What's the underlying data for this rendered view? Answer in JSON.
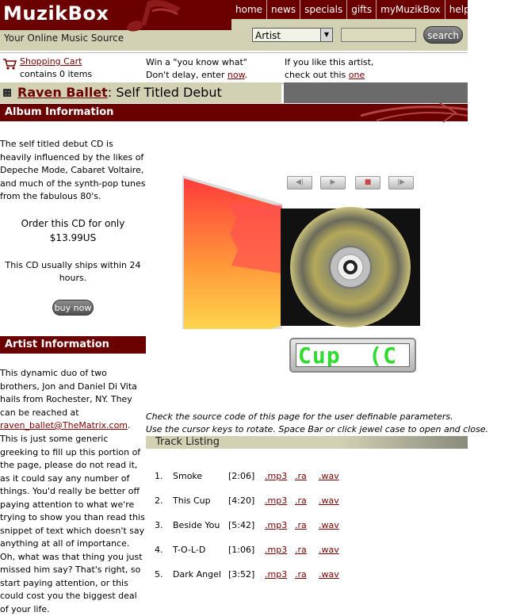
{
  "header": {
    "logo": "MuzikBox",
    "tagline": "Your Online Music Source",
    "nav": [
      "home",
      "news",
      "specials",
      "gifts",
      "myMuzikBox",
      "help"
    ],
    "search": {
      "category": "Artist",
      "value": "",
      "button_label": "search"
    }
  },
  "info": {
    "cart_link": "Shopping Cart",
    "cart_count": "contains 0 items",
    "promo1_line1": "Win a \"you know what\"",
    "promo1_line2_pre": "Don't delay, enter ",
    "promo1_link": "now",
    "promo1_line2_post": ".",
    "promo2_line1": "If you like this artist,",
    "promo2_line2_pre": "check out this ",
    "promo2_link": "one"
  },
  "title": {
    "artist": "Raven Ballet",
    "separator": ": ",
    "album": "Self Titled Debut"
  },
  "album_section": {
    "heading": "Album Information",
    "description": "The self titled debut CD is heavily influenced by the likes of Depeche Mode, Cabaret Voltaire, and much of the synth-pop tunes from the fabulous 80's.",
    "order_line": "Order this CD for only",
    "price": "$13.99US",
    "shipping": "This CD usually ships within 24 hours.",
    "buy_label": "buy now"
  },
  "artist_section": {
    "heading": "Artist Information",
    "description_pre": "This dynamic duo of two brothers, Jon and Daniel Di Vita hails from Rochester, NY. They can be reached at ",
    "email": "raven_ballet@TheMatrix.com",
    "description_post": ".",
    "greeking": "This is just some generic greeking to fill up this portion of the page, please do not read it, as it could say any number of things. You'd really be better off paying attention to what we're trying to show you than read this snippet of text which doesn't say anything at all of importance. Oh, what was that thing you just missed him say? That's right, so start paying attention, or this could cost you the biggest deal of your life."
  },
  "player": {
    "display_text": "Cup  (C",
    "controls": [
      "previous",
      "play",
      "stop",
      "next"
    ],
    "display_color": "#2edb2e"
  },
  "instructions": {
    "line1": "Check the source code of this page for the user definable parameters.",
    "line2": "Use the cursor keys to rotate. Space Bar or click jewel case to open and close."
  },
  "tracks": {
    "heading": "Track Listing",
    "items": [
      {
        "num": "1.",
        "name": "Smoke",
        "length": "[2:06]",
        "mp3": ".mp3",
        "ra": ".ra",
        "wav": ".wav"
      },
      {
        "num": "2.",
        "name": "This Cup",
        "length": "[4:20]",
        "mp3": ".mp3",
        "ra": ".ra",
        "wav": ".wav"
      },
      {
        "num": "3.",
        "name": "Beside You",
        "length": "[5:42]",
        "mp3": ".mp3",
        "ra": ".ra",
        "wav": ".wav"
      },
      {
        "num": "4.",
        "name": "T-O-L-D",
        "length": "[1:06]",
        "mp3": ".mp3",
        "ra": ".ra",
        "wav": ".wav"
      },
      {
        "num": "5.",
        "name": "Dark Angel",
        "length": "[3:52]",
        "mp3": ".mp3",
        "ra": ".ra",
        "wav": ".wav"
      }
    ]
  },
  "colors": {
    "brand": "#6b0000",
    "header_bg": "#d3d1b4",
    "link": "#7a0000"
  }
}
